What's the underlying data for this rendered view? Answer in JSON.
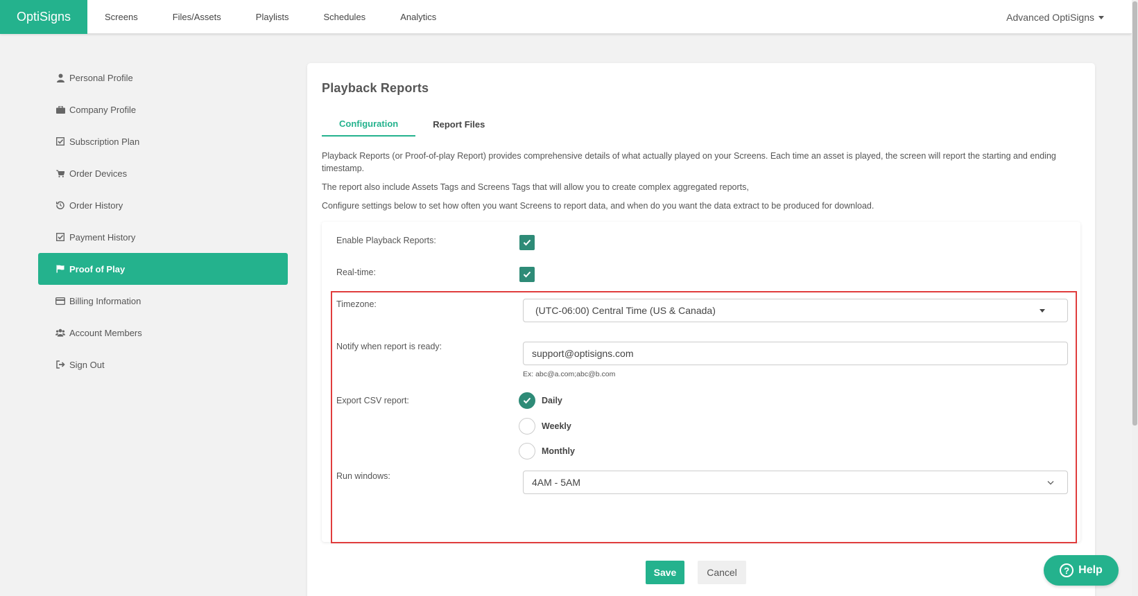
{
  "nav": {
    "brand": "OptiSigns",
    "links": [
      "Screens",
      "Files/Assets",
      "Playlists",
      "Schedules",
      "Analytics"
    ],
    "account": "Advanced OptiSigns"
  },
  "sidebar": {
    "items": [
      {
        "label": "Personal Profile",
        "icon": "user-icon"
      },
      {
        "label": "Company Profile",
        "icon": "briefcase-icon"
      },
      {
        "label": "Subscription Plan",
        "icon": "checkbox-icon"
      },
      {
        "label": "Order Devices",
        "icon": "cart-icon"
      },
      {
        "label": "Order History",
        "icon": "history-icon"
      },
      {
        "label": "Payment History",
        "icon": "checkbox-icon"
      },
      {
        "label": "Proof of Play",
        "icon": "flag-icon",
        "active": true
      },
      {
        "label": "Billing Information",
        "icon": "credit-card-icon"
      },
      {
        "label": "Account Members",
        "icon": "users-icon"
      },
      {
        "label": "Sign Out",
        "icon": "sign-out-icon"
      }
    ]
  },
  "main": {
    "title": "Playback Reports",
    "tabs": [
      {
        "label": "Configuration",
        "active": true
      },
      {
        "label": "Report Files"
      }
    ],
    "description": [
      "Playback Reports (or Proof-of-play Report) provides comprehensive details of what actually played on your Screens. Each time an asset is played, the screen will report the starting and ending timestamp.",
      "The report also include Assets Tags and Screens Tags that will allow you to create complex aggregated reports,",
      "Configure settings below to set how often you want Screens to report data, and when do you want the data extract to be produced for download."
    ],
    "form": {
      "enable_label": "Enable Playback Reports:",
      "enable_checked": true,
      "realtime_label": "Real-time:",
      "realtime_checked": true,
      "timezone_label": "Timezone:",
      "timezone_value": "(UTC-06:00) Central Time (US & Canada)",
      "notify_label": "Notify when report is ready:",
      "notify_value": "support@optisigns.com",
      "notify_hint": "Ex: abc@a.com;abc@b.com",
      "export_label": "Export CSV report:",
      "export_options": [
        "Daily",
        "Weekly",
        "Monthly"
      ],
      "export_selected": "Daily",
      "run_label": "Run windows:",
      "run_value": "4AM - 5AM"
    },
    "save_label": "Save",
    "cancel_label": "Cancel"
  },
  "help_label": "Help",
  "colors": {
    "accent": "#24b28d",
    "checkbox": "#2e8b77",
    "highlight": "#e03c3c"
  }
}
